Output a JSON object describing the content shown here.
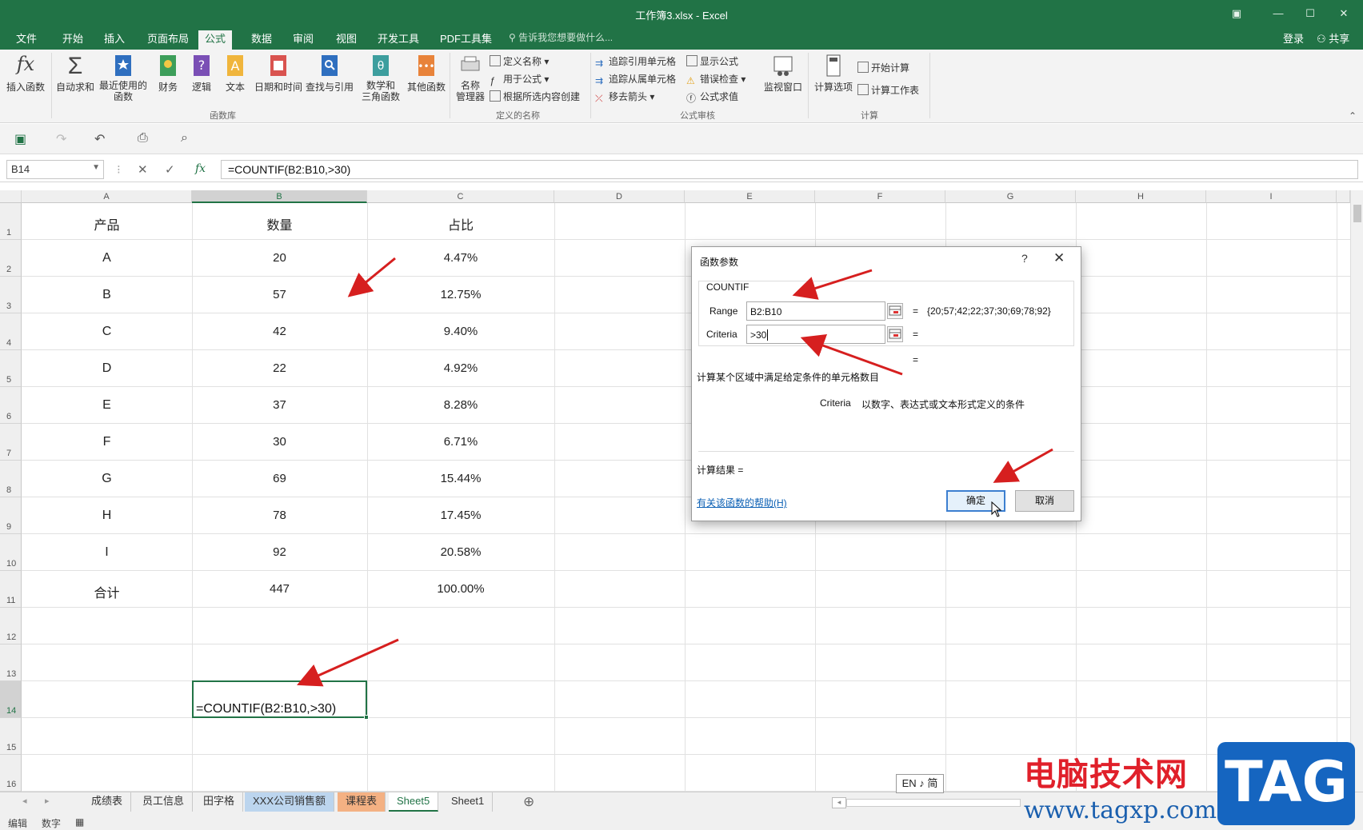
{
  "window": {
    "title": "工作簿3.xlsx - Excel",
    "controls": [
      "▣",
      "—",
      "☐",
      "✕"
    ]
  },
  "tabs": [
    "文件",
    "开始",
    "插入",
    "页面布局",
    "公式",
    "数据",
    "审阅",
    "视图",
    "开发工具",
    "PDF工具集"
  ],
  "active_tab": "公式",
  "tell_me": "告诉我您想要做什么...",
  "login": "登录",
  "share": "共享",
  "ribbon": {
    "function_library": {
      "label": "函数库",
      "buttons": [
        "插入函数",
        "自动求和",
        "最近使用的\n函数",
        "财务",
        "逻辑",
        "文本",
        "日期和时间",
        "查找与引用",
        "数学和\n三角函数",
        "其他函数"
      ]
    },
    "defined_names": {
      "label": "定义的名称",
      "manager": "名称\n管理器",
      "items": [
        "定义名称",
        "用于公式",
        "根据所选内容创建"
      ]
    },
    "formula_auditing": {
      "label": "公式审核",
      "items": [
        "追踪引用单元格",
        "追踪从属单元格",
        "移去箭头",
        "显示公式",
        "错误检查",
        "公式求值"
      ],
      "watch": "监视窗口"
    },
    "calculation": {
      "label": "计算",
      "options": "计算选项",
      "items": [
        "开始计算",
        "计算工作表"
      ]
    }
  },
  "formula_bar": {
    "name_box": "B14",
    "formula": "=COUNTIF(B2:B10,>30)",
    "cancel": "✕",
    "enter": "✓",
    "fx": "fx"
  },
  "columns": [
    "A",
    "B",
    "C",
    "D",
    "E",
    "F",
    "G",
    "H",
    "I"
  ],
  "rows": [
    "1",
    "2",
    "3",
    "4",
    "5",
    "6",
    "7",
    "8",
    "9",
    "10",
    "11",
    "12",
    "13",
    "14",
    "15",
    "16"
  ],
  "table": {
    "header": [
      "产品",
      "数量",
      "占比"
    ],
    "data": [
      [
        "A",
        "20",
        "4.47%"
      ],
      [
        "B",
        "57",
        "12.75%"
      ],
      [
        "C",
        "42",
        "9.40%"
      ],
      [
        "D",
        "22",
        "4.92%"
      ],
      [
        "E",
        "37",
        "8.28%"
      ],
      [
        "F",
        "30",
        "6.71%"
      ],
      [
        "G",
        "69",
        "15.44%"
      ],
      [
        "H",
        "78",
        "17.45%"
      ],
      [
        "I",
        "92",
        "20.58%"
      ],
      [
        "合计",
        "447",
        "100.00%"
      ]
    ]
  },
  "active_cell_text": "=COUNTIF(B2:B10,>30)",
  "dialog": {
    "title": "函数参数",
    "help_icon": "?",
    "close_icon": "✕",
    "function": "COUNTIF",
    "range_label": "Range",
    "range_value": "B2:B10",
    "range_result": "{20;57;42;22;37;30;69;78;92}",
    "criteria_label": "Criteria",
    "criteria_value": ">30",
    "eq": "=",
    "description": "计算某个区域中满足给定条件的单元格数目",
    "criteria_desc_label": "Criteria",
    "criteria_desc": "以数字、表达式或文本形式定义的条件",
    "result_label": "计算结果 =",
    "help_link": "有关该函数的帮助(H)",
    "ok": "确定",
    "cancel": "取消"
  },
  "sheets": [
    "成绩表",
    "员工信息",
    "田字格",
    "XXX公司销售额",
    "课程表",
    "Sheet5",
    "Sheet1"
  ],
  "active_sheet": "Sheet5",
  "add_sheet": "⊕",
  "status": {
    "mode": "编辑",
    "num": "数字"
  },
  "ime": "EN ♪ 简",
  "watermark": {
    "cn": "电脑技术网",
    "url": "www.tagxp.com",
    "tag": "TAG"
  },
  "colors": {
    "excel_green": "#217346",
    "arrow_red": "#d61f1f"
  }
}
